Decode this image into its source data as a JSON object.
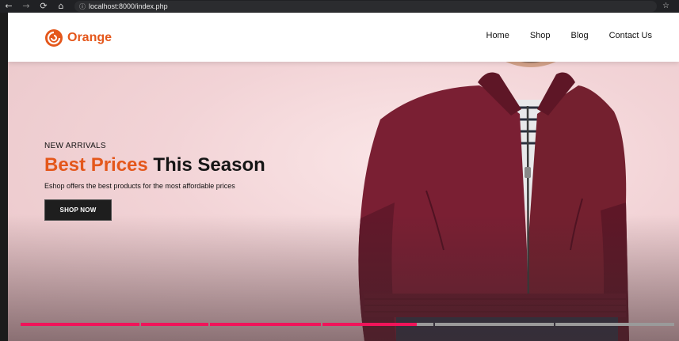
{
  "browser": {
    "url": "localhost:8000/index.php",
    "icons": [
      "back-arrow-icon",
      "forward-arrow-icon",
      "reload-icon",
      "home-icon",
      "info-icon",
      "star-icon"
    ]
  },
  "header": {
    "logo_text": "Orange",
    "nav": [
      "Home",
      "Shop",
      "Blog",
      "Contact Us"
    ]
  },
  "hero": {
    "eyebrow": "NEW ARRIVALS",
    "headline_accent": "Best Prices",
    "headline_rest": "This Season",
    "subtext": "Eshop offers the best products for the most affordable prices",
    "cta": "SHOP NOW"
  },
  "slider_progress": {
    "slides": 6,
    "filled_fraction": 0.61
  },
  "colors": {
    "brand": "#e4571b",
    "progress_active": "#f0145a",
    "progress_inactive": "#9a9a9a",
    "hero_bg": "#f0d6d8",
    "jacket": "#7a1f33"
  }
}
